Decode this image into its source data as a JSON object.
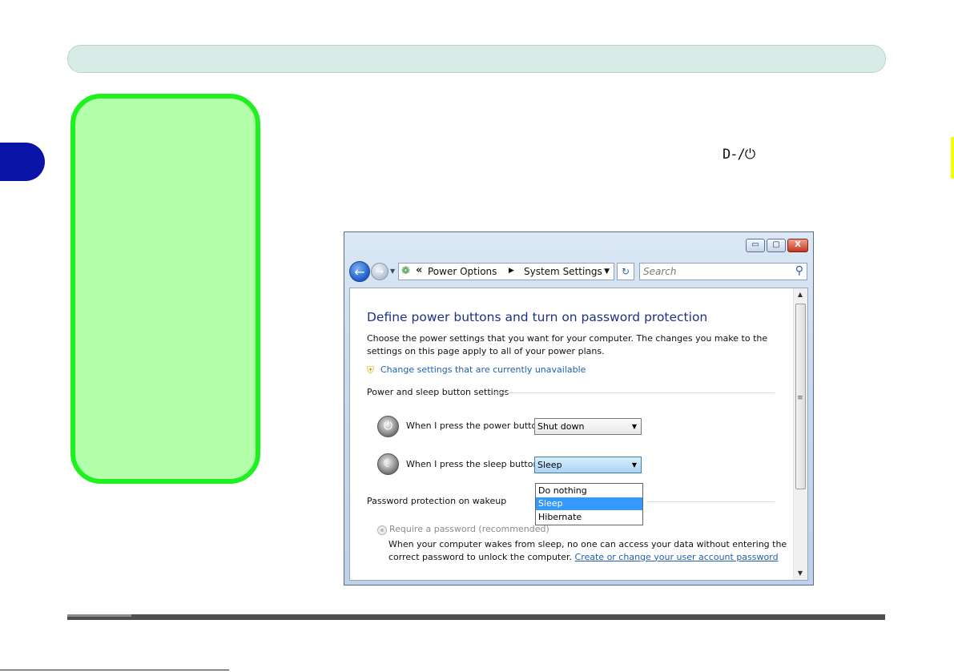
{
  "page": {
    "adapter_power_symbol": "D-/⏻"
  },
  "window": {
    "controls": {
      "minimize": "▭",
      "maximize": "▢",
      "close": "X"
    },
    "breadcrumb": [
      "Power Options",
      "System Settings"
    ],
    "search_placeholder": "Search",
    "title": "Define power buttons and turn on password protection",
    "description": "Choose the power settings that you want for your computer. The changes you make to the settings on this page apply to all of your power plans.",
    "change_link": "Change settings that are currently unavailable",
    "power_section": {
      "title": "Power and sleep button settings",
      "power_label": "When I press the power button:",
      "power_value": "Shut down",
      "sleep_label": "When I press the sleep button:",
      "sleep_value": "Sleep",
      "sleep_options": [
        "Do nothing",
        "Sleep",
        "Hibernate"
      ]
    },
    "password_section": {
      "title": "Password protection on wakeup",
      "radio_label": "Require a password (recommended)",
      "desc_text": "When your computer wakes from sleep, no one can access your data without entering the correct password to unlock the computer.",
      "desc_link": "Create or change your user account password"
    }
  }
}
